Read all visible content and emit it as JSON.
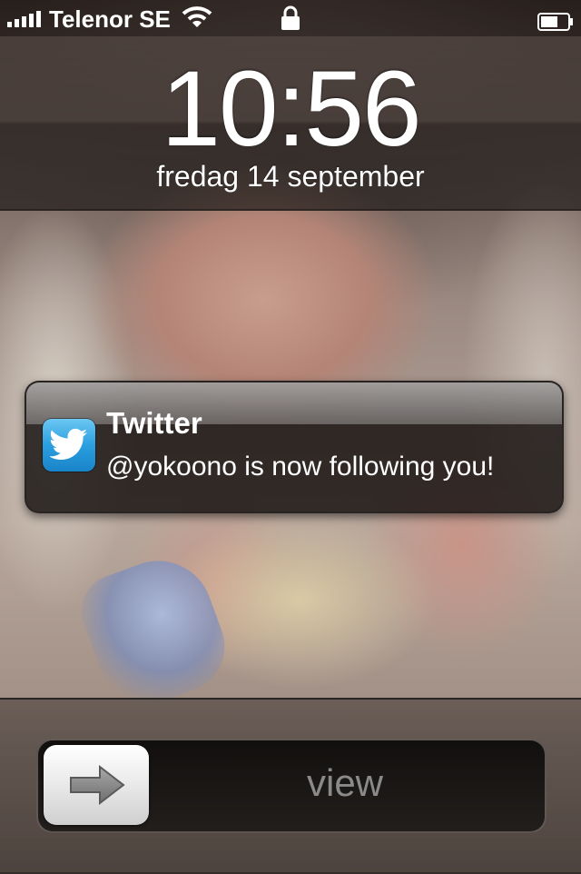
{
  "status_bar": {
    "carrier": "Telenor SE",
    "signal_bars": 5,
    "icons": [
      "signal-icon",
      "wifi-icon",
      "lock-icon",
      "battery-icon"
    ]
  },
  "lock_screen": {
    "time": "10:56",
    "date": "fredag 14 september"
  },
  "notification": {
    "app_icon": "twitter-icon",
    "app_name": "Twitter",
    "message": "@yokoono is now following you!",
    "icon_color": "#2a9fe0"
  },
  "slider": {
    "label": "view",
    "knob_icon": "arrow-right-icon"
  }
}
